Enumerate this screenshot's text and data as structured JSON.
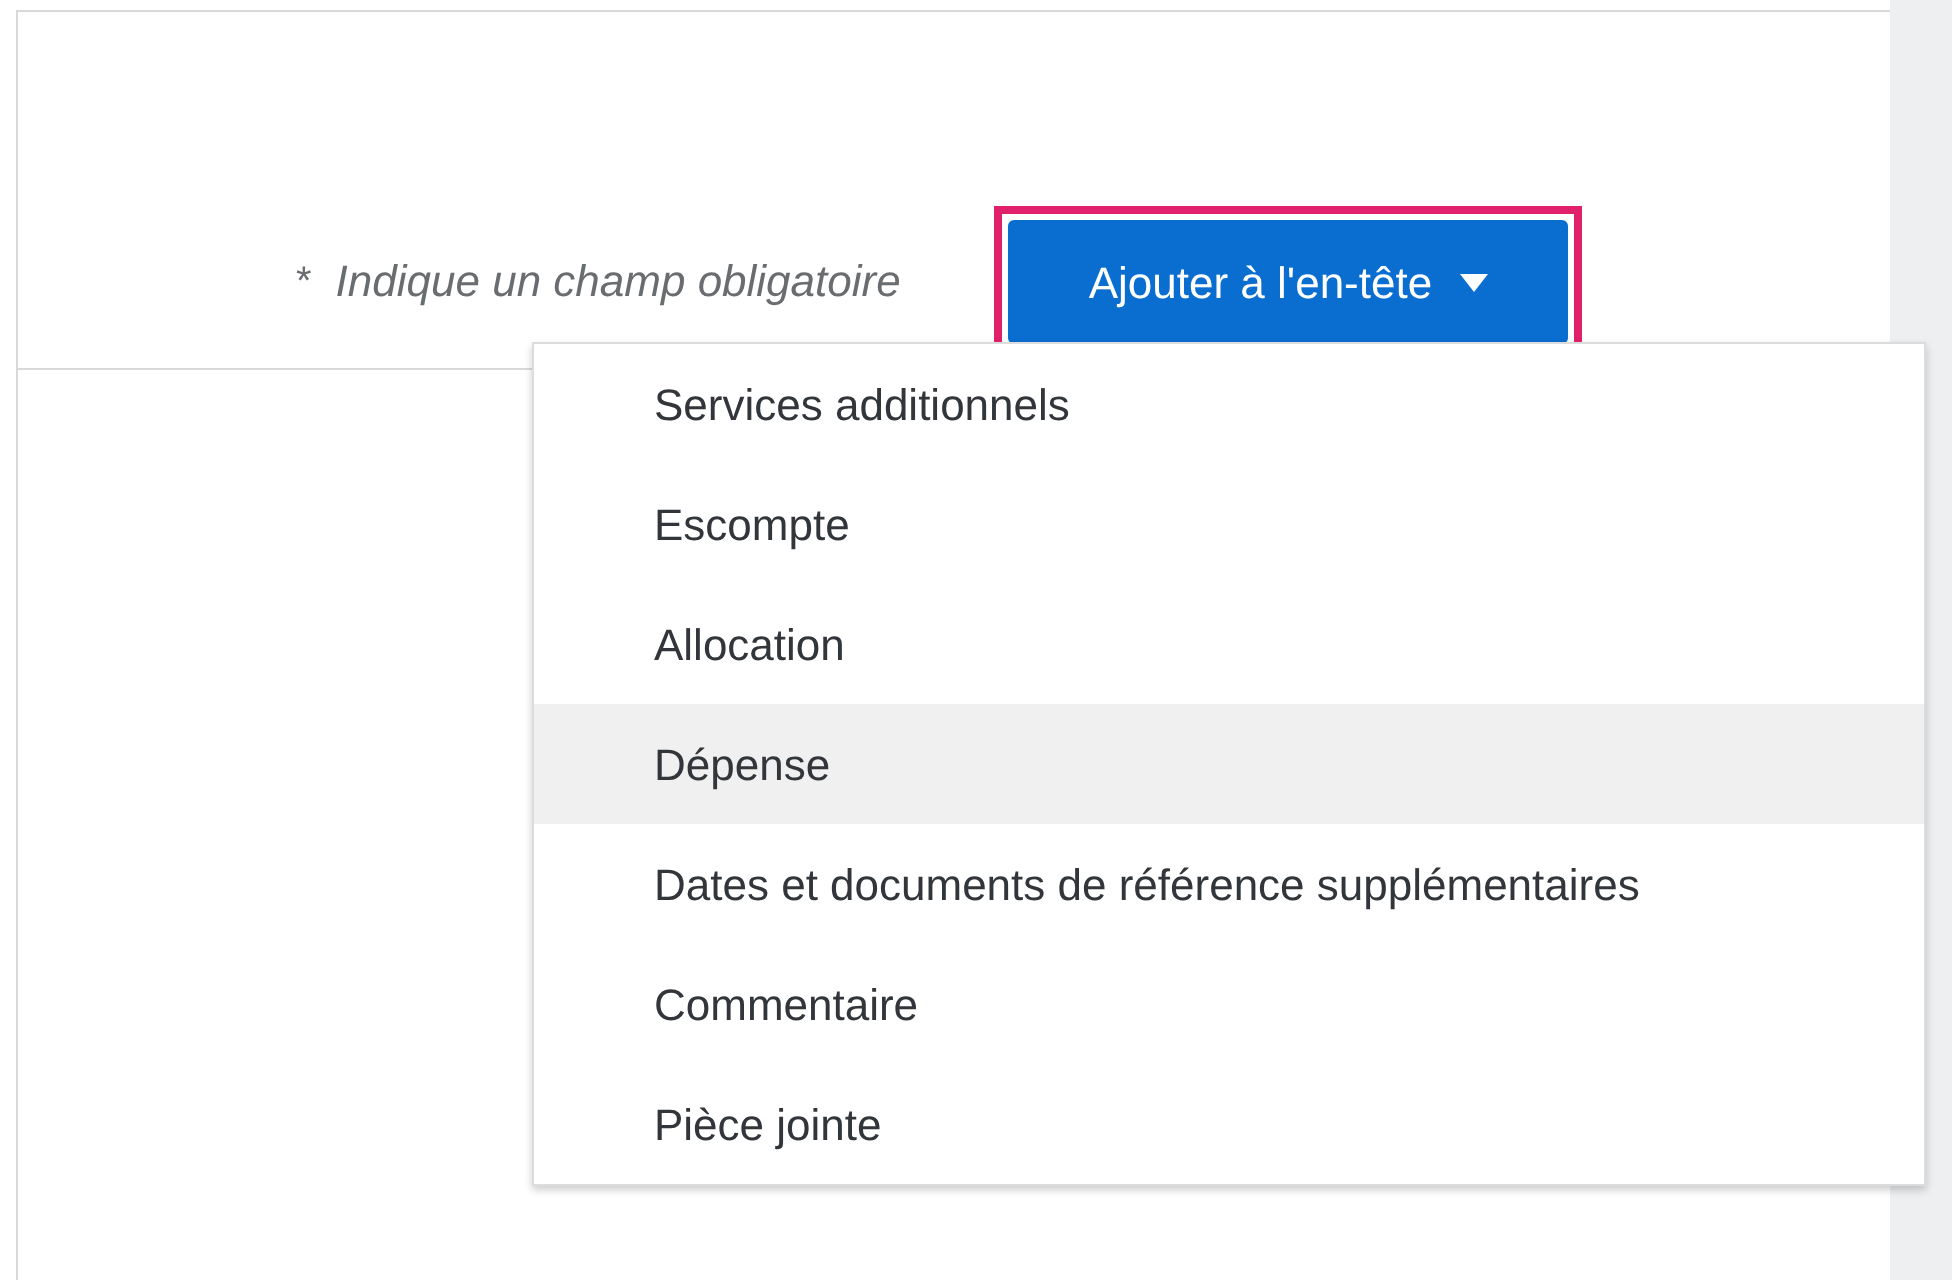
{
  "required_note": {
    "marker": "*",
    "text": "Indique un champ obligatoire"
  },
  "add_button": {
    "label": "Ajouter à l'en-tête",
    "highlighted": true,
    "expanded": true
  },
  "menu": [
    {
      "label": "Services additionnels",
      "hovered": false
    },
    {
      "label": "Escompte",
      "hovered": false
    },
    {
      "label": "Allocation",
      "hovered": false
    },
    {
      "label": "Dépense",
      "hovered": true
    },
    {
      "label": "Dates et documents de référence supplémentaires",
      "hovered": false
    },
    {
      "label": "Commentaire",
      "hovered": false
    },
    {
      "label": "Pièce jointe",
      "hovered": false
    }
  ]
}
